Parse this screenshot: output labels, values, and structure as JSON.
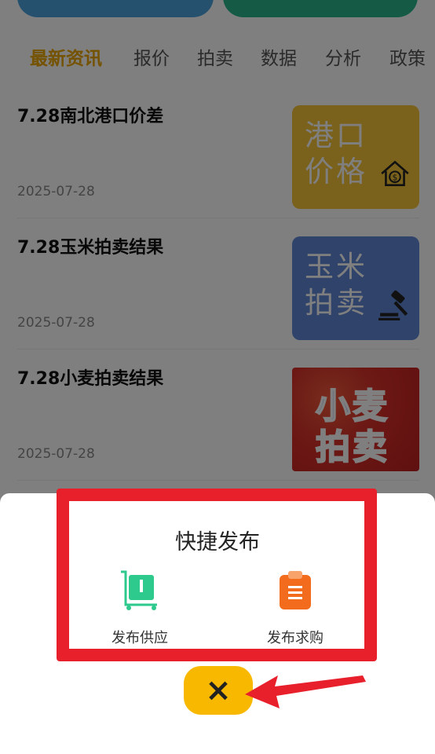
{
  "tabs": [
    "最新资讯",
    "报价",
    "拍卖",
    "数据",
    "分析",
    "政策"
  ],
  "news": [
    {
      "title": "7.28南北港口价差",
      "date": "2025-07-28",
      "thumb_text": [
        "港口",
        "价格"
      ]
    },
    {
      "title": "7.28玉米拍卖结果",
      "date": "2025-07-28",
      "thumb_text": [
        "玉米",
        "拍卖"
      ]
    },
    {
      "title": "7.28小麦拍卖结果",
      "date": "2025-07-28",
      "thumb_text": [
        "小麦",
        "拍卖"
      ]
    }
  ],
  "sheet": {
    "title": "快捷发布",
    "actions": [
      {
        "label": "发布供应",
        "icon": "cart-icon"
      },
      {
        "label": "发布求购",
        "icon": "clipboard-icon"
      }
    ],
    "close_label": "×"
  },
  "colors": {
    "accent": "#f9b800",
    "highlight": "#e8202c",
    "supply_icon": "#2ec98c",
    "demand_icon": "#f36b1c"
  }
}
